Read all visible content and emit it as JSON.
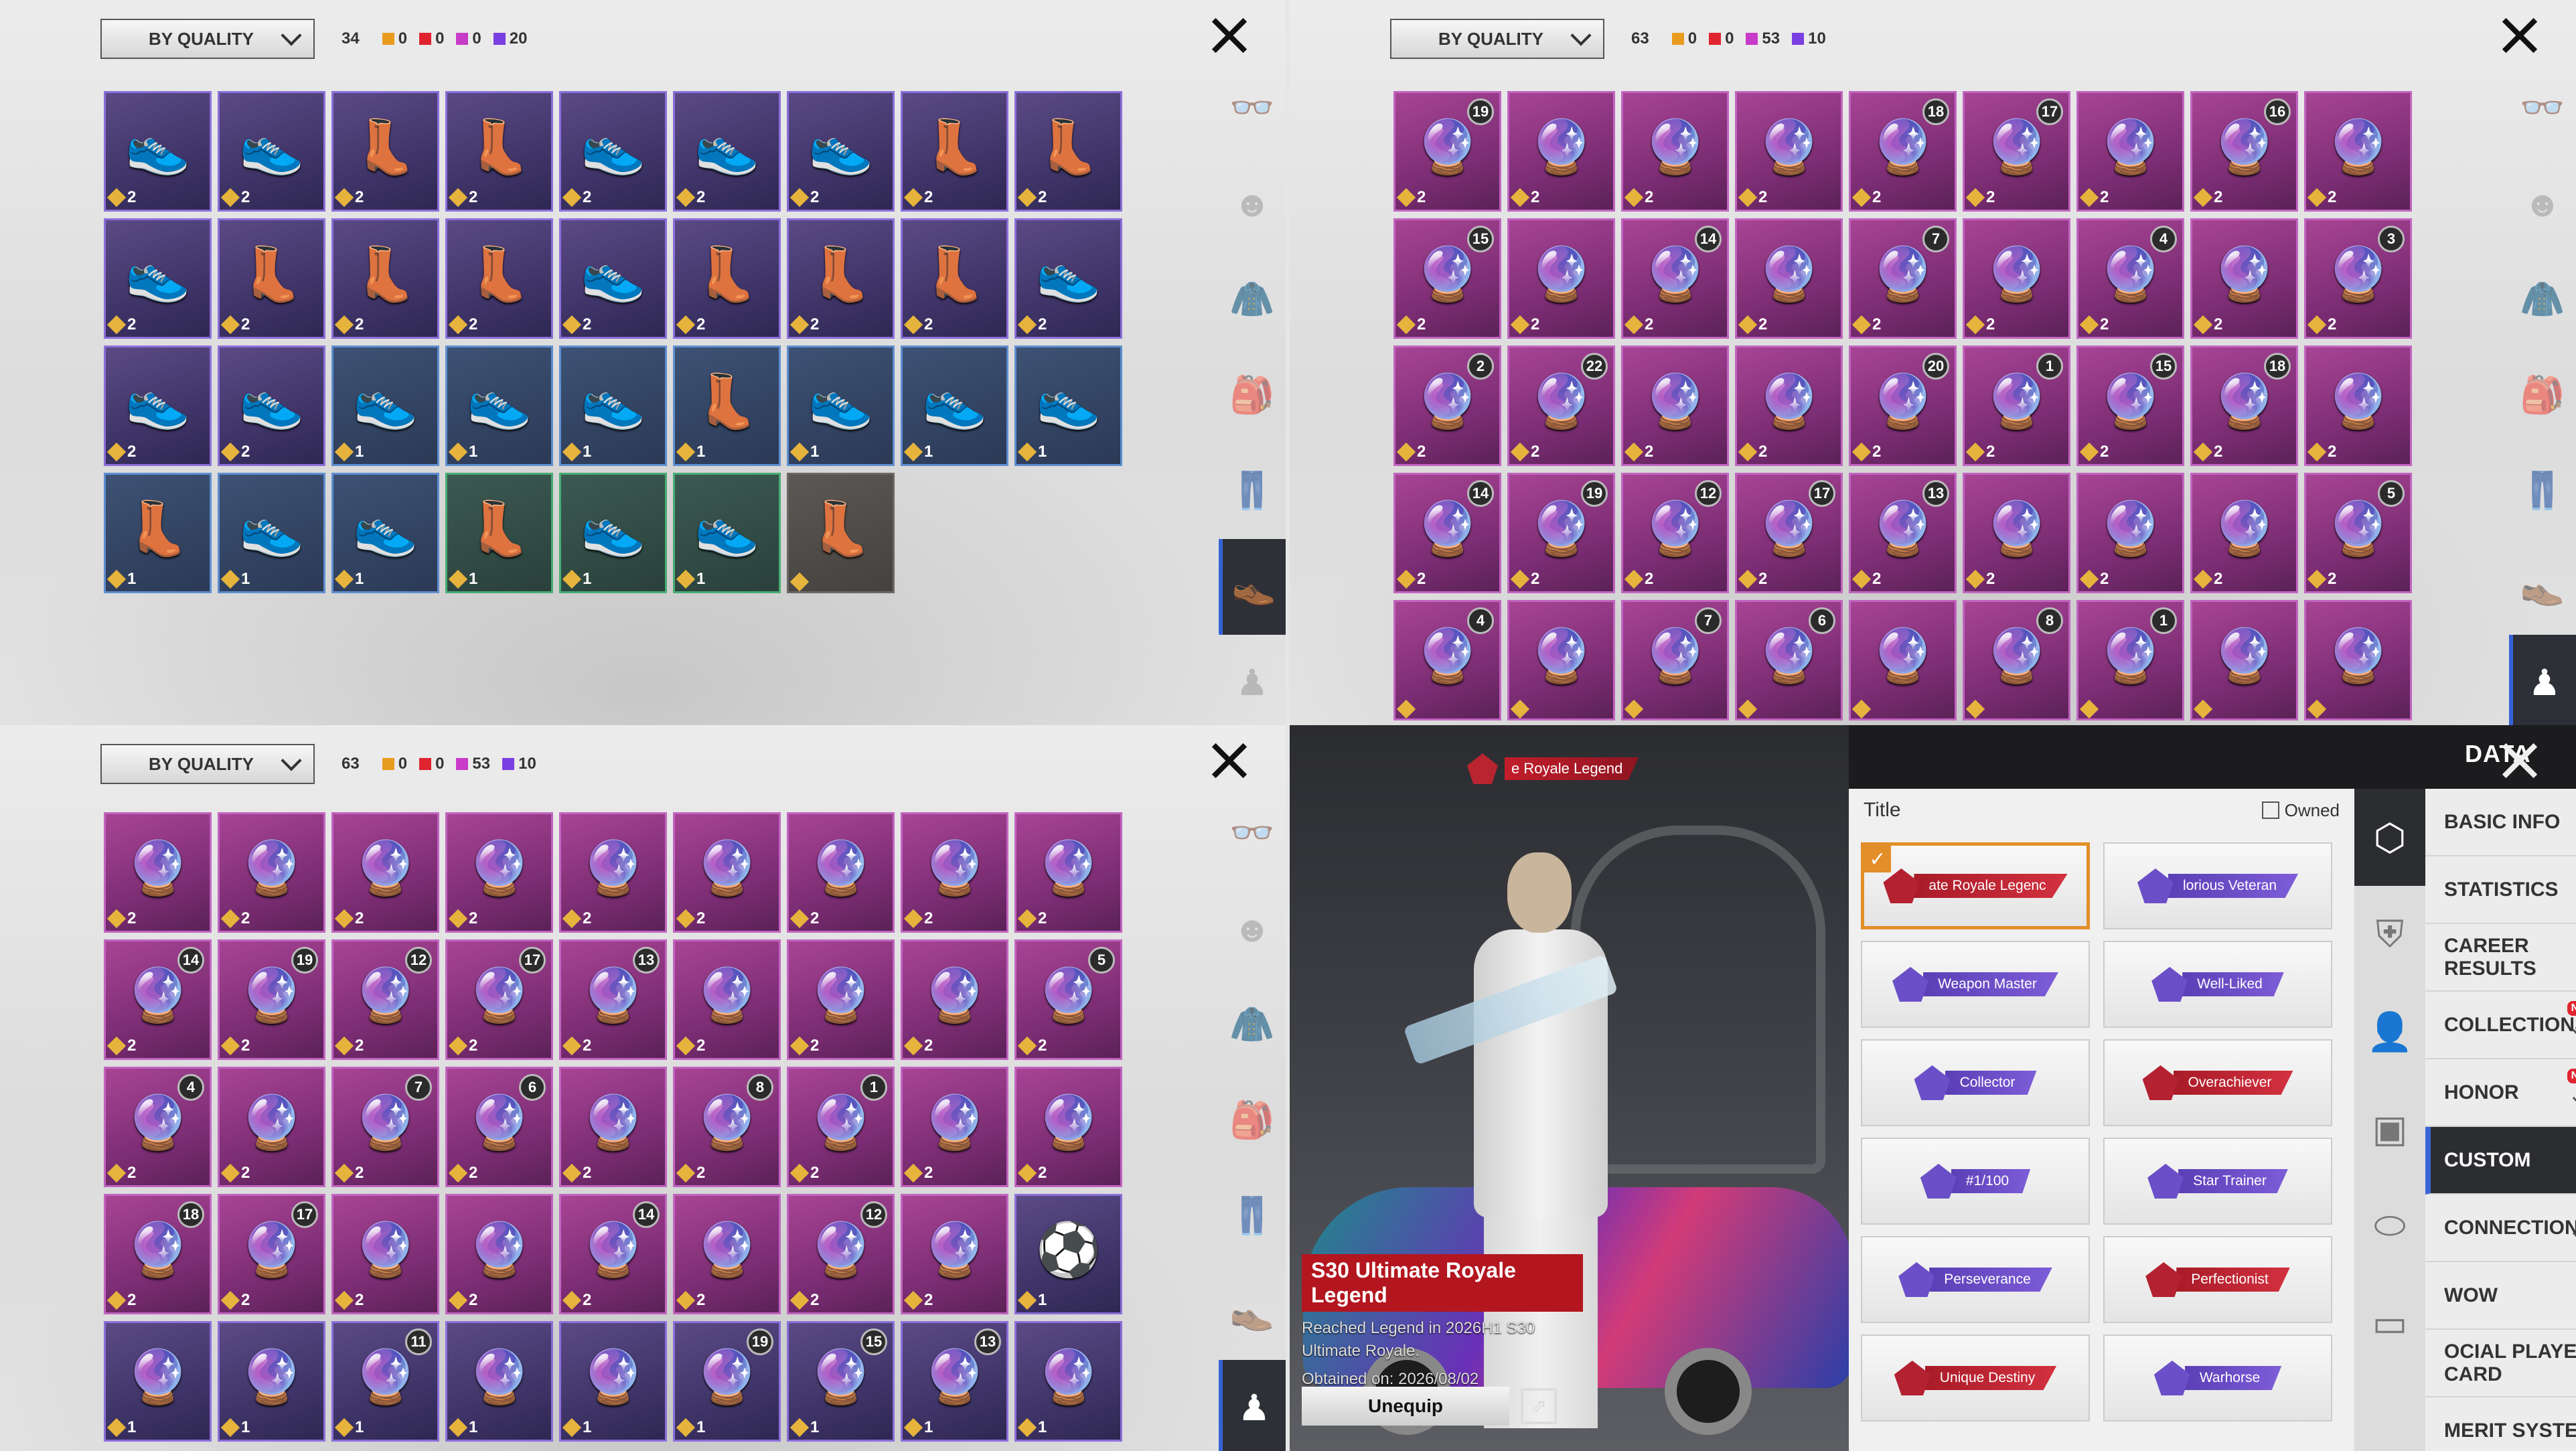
{
  "panels": [
    {
      "sort_label": "BY QUALITY",
      "count": "34",
      "legend": [
        {
          "color": "#e89c1e",
          "value": "0"
        },
        {
          "color": "#e0242f",
          "value": "0"
        },
        {
          "color": "#c83bc8",
          "value": "0"
        },
        {
          "color": "#7a3fe0",
          "value": "20"
        }
      ],
      "tiles": [
        {
          "tier": "purple",
          "icon": "shoe-icon",
          "qty": "2"
        },
        {
          "tier": "purple",
          "icon": "shoe-icon",
          "qty": "2"
        },
        {
          "tier": "purple",
          "icon": "boot-icon",
          "qty": "2"
        },
        {
          "tier": "purple",
          "icon": "boot-icon",
          "qty": "2"
        },
        {
          "tier": "purple",
          "icon": "shoe-icon",
          "qty": "2"
        },
        {
          "tier": "purple",
          "icon": "shoe-icon",
          "qty": "2"
        },
        {
          "tier": "purple",
          "icon": "shoe-icon",
          "qty": "2"
        },
        {
          "tier": "purple",
          "icon": "boot-icon",
          "qty": "2"
        },
        {
          "tier": "purple",
          "icon": "boot-icon",
          "qty": "2"
        },
        {
          "tier": "purple",
          "icon": "shoe-icon",
          "qty": "2"
        },
        {
          "tier": "purple",
          "icon": "boot-icon",
          "qty": "2"
        },
        {
          "tier": "purple",
          "icon": "boot-icon",
          "qty": "2"
        },
        {
          "tier": "purple",
          "icon": "boot-icon",
          "qty": "2"
        },
        {
          "tier": "purple",
          "icon": "shoe-icon",
          "qty": "2"
        },
        {
          "tier": "purple",
          "icon": "boot-icon",
          "qty": "2"
        },
        {
          "tier": "purple",
          "icon": "boot-icon",
          "qty": "2"
        },
        {
          "tier": "purple",
          "icon": "boot-icon",
          "qty": "2"
        },
        {
          "tier": "purple",
          "icon": "shoe-icon",
          "qty": "2"
        },
        {
          "tier": "purple",
          "icon": "shoe-icon",
          "qty": "2"
        },
        {
          "tier": "purple",
          "icon": "shoe-icon",
          "qty": "2"
        },
        {
          "tier": "blue",
          "icon": "shoe-icon",
          "qty": "1"
        },
        {
          "tier": "blue",
          "icon": "shoe-icon",
          "qty": "1"
        },
        {
          "tier": "blue",
          "icon": "shoe-icon",
          "qty": "1"
        },
        {
          "tier": "blue",
          "icon": "boot-icon",
          "qty": "1"
        },
        {
          "tier": "blue",
          "icon": "shoe-icon",
          "qty": "1"
        },
        {
          "tier": "blue",
          "icon": "shoe-icon",
          "qty": "1"
        },
        {
          "tier": "blue",
          "icon": "shoe-icon",
          "qty": "1"
        },
        {
          "tier": "blue",
          "icon": "boot-icon",
          "qty": "1"
        },
        {
          "tier": "blue",
          "icon": "shoe-icon",
          "qty": "1"
        },
        {
          "tier": "blue",
          "icon": "shoe-icon",
          "qty": "1"
        },
        {
          "tier": "green",
          "icon": "boot-icon",
          "qty": "1"
        },
        {
          "tier": "green",
          "icon": "shoe-icon",
          "qty": "1"
        },
        {
          "tier": "green",
          "icon": "shoe-icon",
          "qty": "1"
        },
        {
          "tier": "grey",
          "icon": "boot-icon",
          "qty": ""
        }
      ],
      "active_tab": 5
    },
    {
      "sort_label": "BY QUALITY",
      "count": "63",
      "legend": [
        {
          "color": "#e89c1e",
          "value": "0"
        },
        {
          "color": "#e0242f",
          "value": "0"
        },
        {
          "color": "#c83bc8",
          "value": "53"
        },
        {
          "color": "#7a3fe0",
          "value": "10"
        }
      ],
      "tiles": [
        {
          "tier": "magenta",
          "icon": "charm-icon",
          "qty": "2",
          "badge": "19"
        },
        {
          "tier": "magenta",
          "icon": "charm-icon",
          "qty": "2"
        },
        {
          "tier": "magenta",
          "icon": "charm-icon",
          "qty": "2"
        },
        {
          "tier": "magenta",
          "icon": "charm-icon",
          "qty": "2"
        },
        {
          "tier": "magenta",
          "icon": "charm-icon",
          "qty": "2",
          "badge": "18"
        },
        {
          "tier": "magenta",
          "icon": "charm-icon",
          "qty": "2",
          "badge": "17"
        },
        {
          "tier": "magenta",
          "icon": "charm-icon",
          "qty": "2"
        },
        {
          "tier": "magenta",
          "icon": "charm-icon",
          "qty": "2",
          "badge": "16"
        },
        {
          "tier": "magenta",
          "icon": "charm-icon",
          "qty": "2"
        },
        {
          "tier": "magenta",
          "icon": "charm-icon",
          "qty": "2",
          "badge": "15"
        },
        {
          "tier": "magenta",
          "icon": "charm-icon",
          "qty": "2"
        },
        {
          "tier": "magenta",
          "icon": "charm-icon",
          "qty": "2",
          "badge": "14"
        },
        {
          "tier": "magenta",
          "icon": "charm-icon",
          "qty": "2"
        },
        {
          "tier": "magenta",
          "icon": "charm-icon",
          "qty": "2",
          "badge": "7"
        },
        {
          "tier": "magenta",
          "icon": "charm-icon",
          "qty": "2"
        },
        {
          "tier": "magenta",
          "icon": "charm-icon",
          "qty": "2",
          "badge": "4"
        },
        {
          "tier": "magenta",
          "icon": "charm-icon",
          "qty": "2"
        },
        {
          "tier": "magenta",
          "icon": "charm-icon",
          "qty": "2",
          "badge": "3"
        },
        {
          "tier": "magenta",
          "icon": "charm-icon",
          "qty": "2",
          "badge": "2"
        },
        {
          "tier": "magenta",
          "icon": "charm-icon",
          "qty": "2",
          "badge": "22"
        },
        {
          "tier": "magenta",
          "icon": "charm-icon",
          "qty": "2"
        },
        {
          "tier": "magenta",
          "icon": "charm-icon",
          "qty": "2"
        },
        {
          "tier": "magenta",
          "icon": "charm-icon",
          "qty": "2",
          "badge": "20"
        },
        {
          "tier": "magenta",
          "icon": "charm-icon",
          "qty": "2",
          "badge": "1"
        },
        {
          "tier": "magenta",
          "icon": "charm-icon",
          "qty": "2",
          "badge": "15"
        },
        {
          "tier": "magenta",
          "icon": "charm-icon",
          "qty": "2",
          "badge": "18"
        },
        {
          "tier": "magenta",
          "icon": "charm-icon",
          "qty": "2"
        },
        {
          "tier": "magenta",
          "icon": "charm-icon",
          "qty": "2",
          "badge": "14"
        },
        {
          "tier": "magenta",
          "icon": "charm-icon",
          "qty": "2",
          "badge": "19"
        },
        {
          "tier": "magenta",
          "icon": "charm-icon",
          "qty": "2",
          "badge": "12"
        },
        {
          "tier": "magenta",
          "icon": "charm-icon",
          "qty": "2",
          "badge": "17"
        },
        {
          "tier": "magenta",
          "icon": "charm-icon",
          "qty": "2",
          "badge": "13"
        },
        {
          "tier": "magenta",
          "icon": "charm-icon",
          "qty": "2"
        },
        {
          "tier": "magenta",
          "icon": "charm-icon",
          "qty": "2"
        },
        {
          "tier": "magenta",
          "icon": "charm-icon",
          "qty": "2"
        },
        {
          "tier": "magenta",
          "icon": "charm-icon",
          "qty": "2",
          "badge": "5"
        },
        {
          "tier": "magenta",
          "icon": "charm-icon",
          "qty": "",
          "badge": "4"
        },
        {
          "tier": "magenta",
          "icon": "charm-icon",
          "qty": ""
        },
        {
          "tier": "magenta",
          "icon": "charm-icon",
          "qty": "",
          "badge": "7"
        },
        {
          "tier": "magenta",
          "icon": "charm-icon",
          "qty": "",
          "badge": "6"
        },
        {
          "tier": "magenta",
          "icon": "charm-icon",
          "qty": ""
        },
        {
          "tier": "magenta",
          "icon": "charm-icon",
          "qty": "",
          "badge": "8"
        },
        {
          "tier": "magenta",
          "icon": "charm-icon",
          "qty": "",
          "badge": "1"
        },
        {
          "tier": "magenta",
          "icon": "charm-icon",
          "qty": ""
        },
        {
          "tier": "magenta",
          "icon": "charm-icon",
          "qty": ""
        }
      ],
      "active_tab": 6
    },
    {
      "sort_label": "BY QUALITY",
      "count": "63",
      "legend": [
        {
          "color": "#e89c1e",
          "value": "0"
        },
        {
          "color": "#e0242f",
          "value": "0"
        },
        {
          "color": "#c83bc8",
          "value": "53"
        },
        {
          "color": "#7a3fe0",
          "value": "10"
        }
      ],
      "tiles": [
        {
          "tier": "magenta",
          "icon": "charm-icon",
          "qty": "2"
        },
        {
          "tier": "magenta",
          "icon": "charm-icon",
          "qty": "2"
        },
        {
          "tier": "magenta",
          "icon": "charm-icon",
          "qty": "2"
        },
        {
          "tier": "magenta",
          "icon": "charm-icon",
          "qty": "2"
        },
        {
          "tier": "magenta",
          "icon": "charm-icon",
          "qty": "2"
        },
        {
          "tier": "magenta",
          "icon": "charm-icon",
          "qty": "2"
        },
        {
          "tier": "magenta",
          "icon": "charm-icon",
          "qty": "2"
        },
        {
          "tier": "magenta",
          "icon": "charm-icon",
          "qty": "2"
        },
        {
          "tier": "magenta",
          "icon": "charm-icon",
          "qty": "2"
        },
        {
          "tier": "magenta",
          "icon": "charm-icon",
          "qty": "2",
          "badge": "14"
        },
        {
          "tier": "magenta",
          "icon": "charm-icon",
          "qty": "2",
          "badge": "19"
        },
        {
          "tier": "magenta",
          "icon": "charm-icon",
          "qty": "2",
          "badge": "12"
        },
        {
          "tier": "magenta",
          "icon": "charm-icon",
          "qty": "2",
          "badge": "17"
        },
        {
          "tier": "magenta",
          "icon": "charm-icon",
          "qty": "2",
          "badge": "13"
        },
        {
          "tier": "magenta",
          "icon": "charm-icon",
          "qty": "2"
        },
        {
          "tier": "magenta",
          "icon": "charm-icon",
          "qty": "2"
        },
        {
          "tier": "magenta",
          "icon": "charm-icon",
          "qty": "2"
        },
        {
          "tier": "magenta",
          "icon": "charm-icon",
          "qty": "2",
          "badge": "5"
        },
        {
          "tier": "magenta",
          "icon": "charm-icon",
          "qty": "2",
          "badge": "4"
        },
        {
          "tier": "magenta",
          "icon": "charm-icon",
          "qty": "2"
        },
        {
          "tier": "magenta",
          "icon": "charm-icon",
          "qty": "2",
          "badge": "7"
        },
        {
          "tier": "magenta",
          "icon": "charm-icon",
          "qty": "2",
          "badge": "6"
        },
        {
          "tier": "magenta",
          "icon": "charm-icon",
          "qty": "2"
        },
        {
          "tier": "magenta",
          "icon": "charm-icon",
          "qty": "2",
          "badge": "8"
        },
        {
          "tier": "magenta",
          "icon": "charm-icon",
          "qty": "2",
          "badge": "1"
        },
        {
          "tier": "magenta",
          "icon": "charm-icon",
          "qty": "2"
        },
        {
          "tier": "magenta",
          "icon": "charm-icon",
          "qty": "2"
        },
        {
          "tier": "magenta",
          "icon": "charm-icon",
          "qty": "2",
          "badge": "18"
        },
        {
          "tier": "magenta",
          "icon": "charm-icon",
          "qty": "2",
          "badge": "17"
        },
        {
          "tier": "magenta",
          "icon": "charm-icon",
          "qty": "2"
        },
        {
          "tier": "magenta",
          "icon": "charm-icon",
          "qty": "2"
        },
        {
          "tier": "magenta",
          "icon": "charm-icon",
          "qty": "2",
          "badge": "14"
        },
        {
          "tier": "magenta",
          "icon": "charm-icon",
          "qty": "2"
        },
        {
          "tier": "magenta",
          "icon": "charm-icon",
          "qty": "2",
          "badge": "12"
        },
        {
          "tier": "magenta",
          "icon": "charm-icon",
          "qty": "2"
        },
        {
          "tier": "purple",
          "icon": "ball-icon",
          "qty": "1"
        },
        {
          "tier": "purple",
          "icon": "charm-icon",
          "qty": "1"
        },
        {
          "tier": "purple",
          "icon": "charm-icon",
          "qty": "1"
        },
        {
          "tier": "purple",
          "icon": "charm-icon",
          "qty": "1",
          "badge": "11"
        },
        {
          "tier": "purple",
          "icon": "charm-icon",
          "qty": "1"
        },
        {
          "tier": "purple",
          "icon": "charm-icon",
          "qty": "1"
        },
        {
          "tier": "purple",
          "icon": "charm-icon",
          "qty": "1",
          "badge": "19"
        },
        {
          "tier": "purple",
          "icon": "charm-icon",
          "qty": "1",
          "badge": "15"
        },
        {
          "tier": "purple",
          "icon": "charm-icon",
          "qty": "1",
          "badge": "13"
        },
        {
          "tier": "purple",
          "icon": "charm-icon",
          "qty": "1"
        }
      ],
      "active_tab": 6
    }
  ],
  "profile": {
    "header": "DATA",
    "top_title": "e Royale Legend",
    "card_title": "S30 Ultimate Royale Legend",
    "card_desc": "Reached Legend in 2026H1 S30 Ultimate Royale.",
    "card_date": "Obtained on: 2026/08/02",
    "unequip_label": "Unequip",
    "title_label": "Title",
    "owned_label": "Owned",
    "titles": [
      {
        "label": "ate Royale Legenc",
        "style": "red",
        "selected": true
      },
      {
        "label": "lorious Veteran",
        "style": "purple"
      },
      {
        "label": "Weapon Master",
        "style": "purple"
      },
      {
        "label": "Well-Liked",
        "style": "purple"
      },
      {
        "label": "Collector",
        "style": "purple"
      },
      {
        "label": "Overachiever",
        "style": "red"
      },
      {
        "label": "#1/100",
        "style": "purple"
      },
      {
        "label": "Star Trainer",
        "style": "purple"
      },
      {
        "label": "Perseverance",
        "style": "purple"
      },
      {
        "label": "Perfectionist",
        "style": "red"
      },
      {
        "label": "Unique Destiny",
        "style": "red"
      },
      {
        "label": "Warhorse",
        "style": "purple"
      }
    ],
    "menu": [
      {
        "label": "BASIC INFO",
        "dot": true
      },
      {
        "label": "STATISTICS"
      },
      {
        "label": "CAREER RESULTS"
      },
      {
        "label": "COLLECTIONS",
        "new": "NEW",
        "expand": true
      },
      {
        "label": "HONOR",
        "new": "NEW",
        "expand": true
      },
      {
        "label": "CUSTOM",
        "active": true
      },
      {
        "label": "CONNECTIONS",
        "expand": true
      },
      {
        "label": "WOW"
      },
      {
        "label": "OCIAL PLAYER CARD",
        "dot": true
      },
      {
        "label": "MERIT SYSTEM"
      }
    ]
  }
}
